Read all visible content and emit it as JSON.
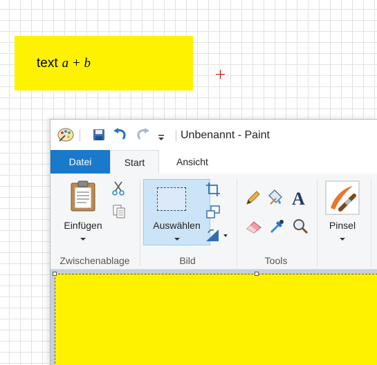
{
  "note": {
    "text": "text",
    "math": "a + b",
    "color": "#fff200"
  },
  "window": {
    "title": "Unbenannt - Paint"
  },
  "tabs": [
    {
      "label": "Datei"
    },
    {
      "label": "Start"
    },
    {
      "label": "Ansicht"
    }
  ],
  "ribbon": {
    "clipboard": {
      "paste_label": "Einfügen",
      "group_label": "Zwischenablage"
    },
    "image": {
      "select_label": "Auswählen",
      "group_label": "Bild"
    },
    "tools": {
      "group_label": "Tools"
    },
    "brushes": {
      "label": "Pinsel"
    }
  },
  "colors": {
    "accent": "#1979ca",
    "selection": "#cce4f7",
    "crosshair": "#e00000"
  }
}
